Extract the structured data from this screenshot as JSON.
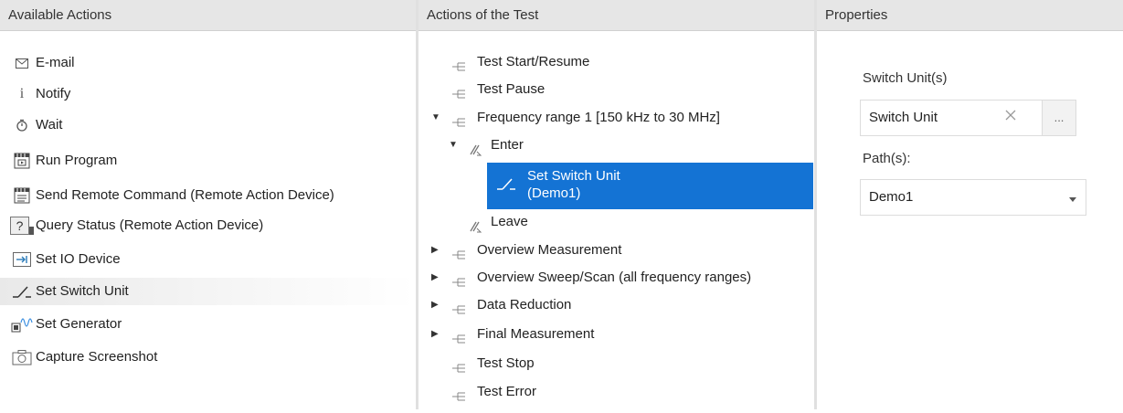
{
  "panels": {
    "available": {
      "title": "Available Actions"
    },
    "test_actions": {
      "title": "Actions of the Test"
    },
    "properties": {
      "title": "Properties"
    }
  },
  "available_actions": [
    {
      "label": "E-mail",
      "icon": "envelope-icon"
    },
    {
      "label": "Notify",
      "icon": "info-icon"
    },
    {
      "label": "Wait",
      "icon": "stopwatch-icon"
    },
    {
      "label": "Run Program",
      "icon": "run-program-icon"
    },
    {
      "label": "Send Remote Command (Remote Action Device)",
      "icon": "remote-command-icon"
    },
    {
      "label": "Query Status (Remote Action Device)",
      "icon": "query-status-icon"
    },
    {
      "label": "Set IO Device",
      "icon": "io-device-icon"
    },
    {
      "label": "Set Switch Unit",
      "icon": "switch-unit-icon"
    },
    {
      "label": "Set Generator",
      "icon": "generator-icon"
    },
    {
      "label": "Capture Screenshot",
      "icon": "camera-icon"
    }
  ],
  "test_tree": [
    {
      "label": "Test Start/Resume"
    },
    {
      "label": "Test Pause"
    },
    {
      "label": "Frequency range 1 [150 kHz to 30 MHz]",
      "expanded": true
    },
    {
      "label": "Enter",
      "expanded": true
    },
    {
      "label": "Leave"
    },
    {
      "label": "Overview Measurement",
      "expanded": false
    },
    {
      "label": "Overview Sweep/Scan (all frequency ranges)",
      "expanded": false
    },
    {
      "label": "Data Reduction",
      "expanded": false
    },
    {
      "label": "Final Measurement",
      "expanded": false
    },
    {
      "label": "Test Stop"
    },
    {
      "label": "Test Error"
    }
  ],
  "selected_node": {
    "line1": "Set Switch Unit",
    "line2": "(Demo1)"
  },
  "properties": {
    "switch_units_label": "Switch Unit(s)",
    "switch_unit_value": "Switch Unit",
    "browse_label": "...",
    "paths_label": "Path(s):",
    "path_value": "Demo1"
  },
  "colors": {
    "selection": "#1473d4",
    "header_bg": "#e6e6e6"
  }
}
